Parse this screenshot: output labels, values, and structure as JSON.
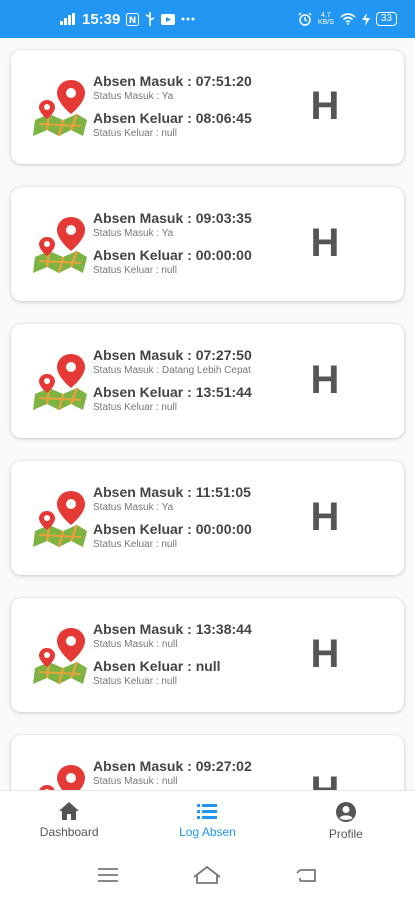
{
  "statusbar": {
    "time": "15:39",
    "net_speed_top": "4.7",
    "net_speed_bottom": "KB/S",
    "battery": "33",
    "colors": {
      "background": "#2196f3",
      "foreground": "#ffffff"
    }
  },
  "logs": [
    {
      "masuk_label": "Absen Masuk : 07:51:20",
      "status_masuk": "Status Masuk : Ya",
      "keluar_label": "Absen Keluar : 08:06:45",
      "status_keluar": "Status Keluar : null",
      "code": "H"
    },
    {
      "masuk_label": "Absen Masuk : 09:03:35",
      "status_masuk": "Status Masuk : Ya",
      "keluar_label": "Absen Keluar : 00:00:00",
      "status_keluar": "Status Keluar : null",
      "code": "H"
    },
    {
      "masuk_label": "Absen Masuk : 07:27:50",
      "status_masuk": "Status Masuk : Datang Lebih Cepat",
      "keluar_label": "Absen Keluar : 13:51:44",
      "status_keluar": "Status Keluar : null",
      "code": "H"
    },
    {
      "masuk_label": "Absen Masuk : 11:51:05",
      "status_masuk": "Status Masuk : Ya",
      "keluar_label": "Absen Keluar : 00:00:00",
      "status_keluar": "Status Keluar : null",
      "code": "H"
    },
    {
      "masuk_label": "Absen Masuk : 13:38:44",
      "status_masuk": "Status Masuk : null",
      "keluar_label": "Absen Keluar : null",
      "status_keluar": "Status Keluar : null",
      "code": "H"
    },
    {
      "masuk_label": "Absen Masuk : 09:27:02",
      "status_masuk": "Status Masuk : null",
      "keluar_label": "",
      "status_keluar": "",
      "code": "H"
    }
  ],
  "bottom_nav": {
    "items": [
      {
        "label": "Dashboard",
        "icon": "home-icon"
      },
      {
        "label": "Log Absen",
        "icon": "list-icon",
        "active": true
      },
      {
        "label": "Profile",
        "icon": "account-circle-icon"
      }
    ],
    "active_color": "#2196f3"
  },
  "system_nav": {
    "icons": [
      "menu-icon",
      "home-outline-icon",
      "back-icon"
    ]
  }
}
